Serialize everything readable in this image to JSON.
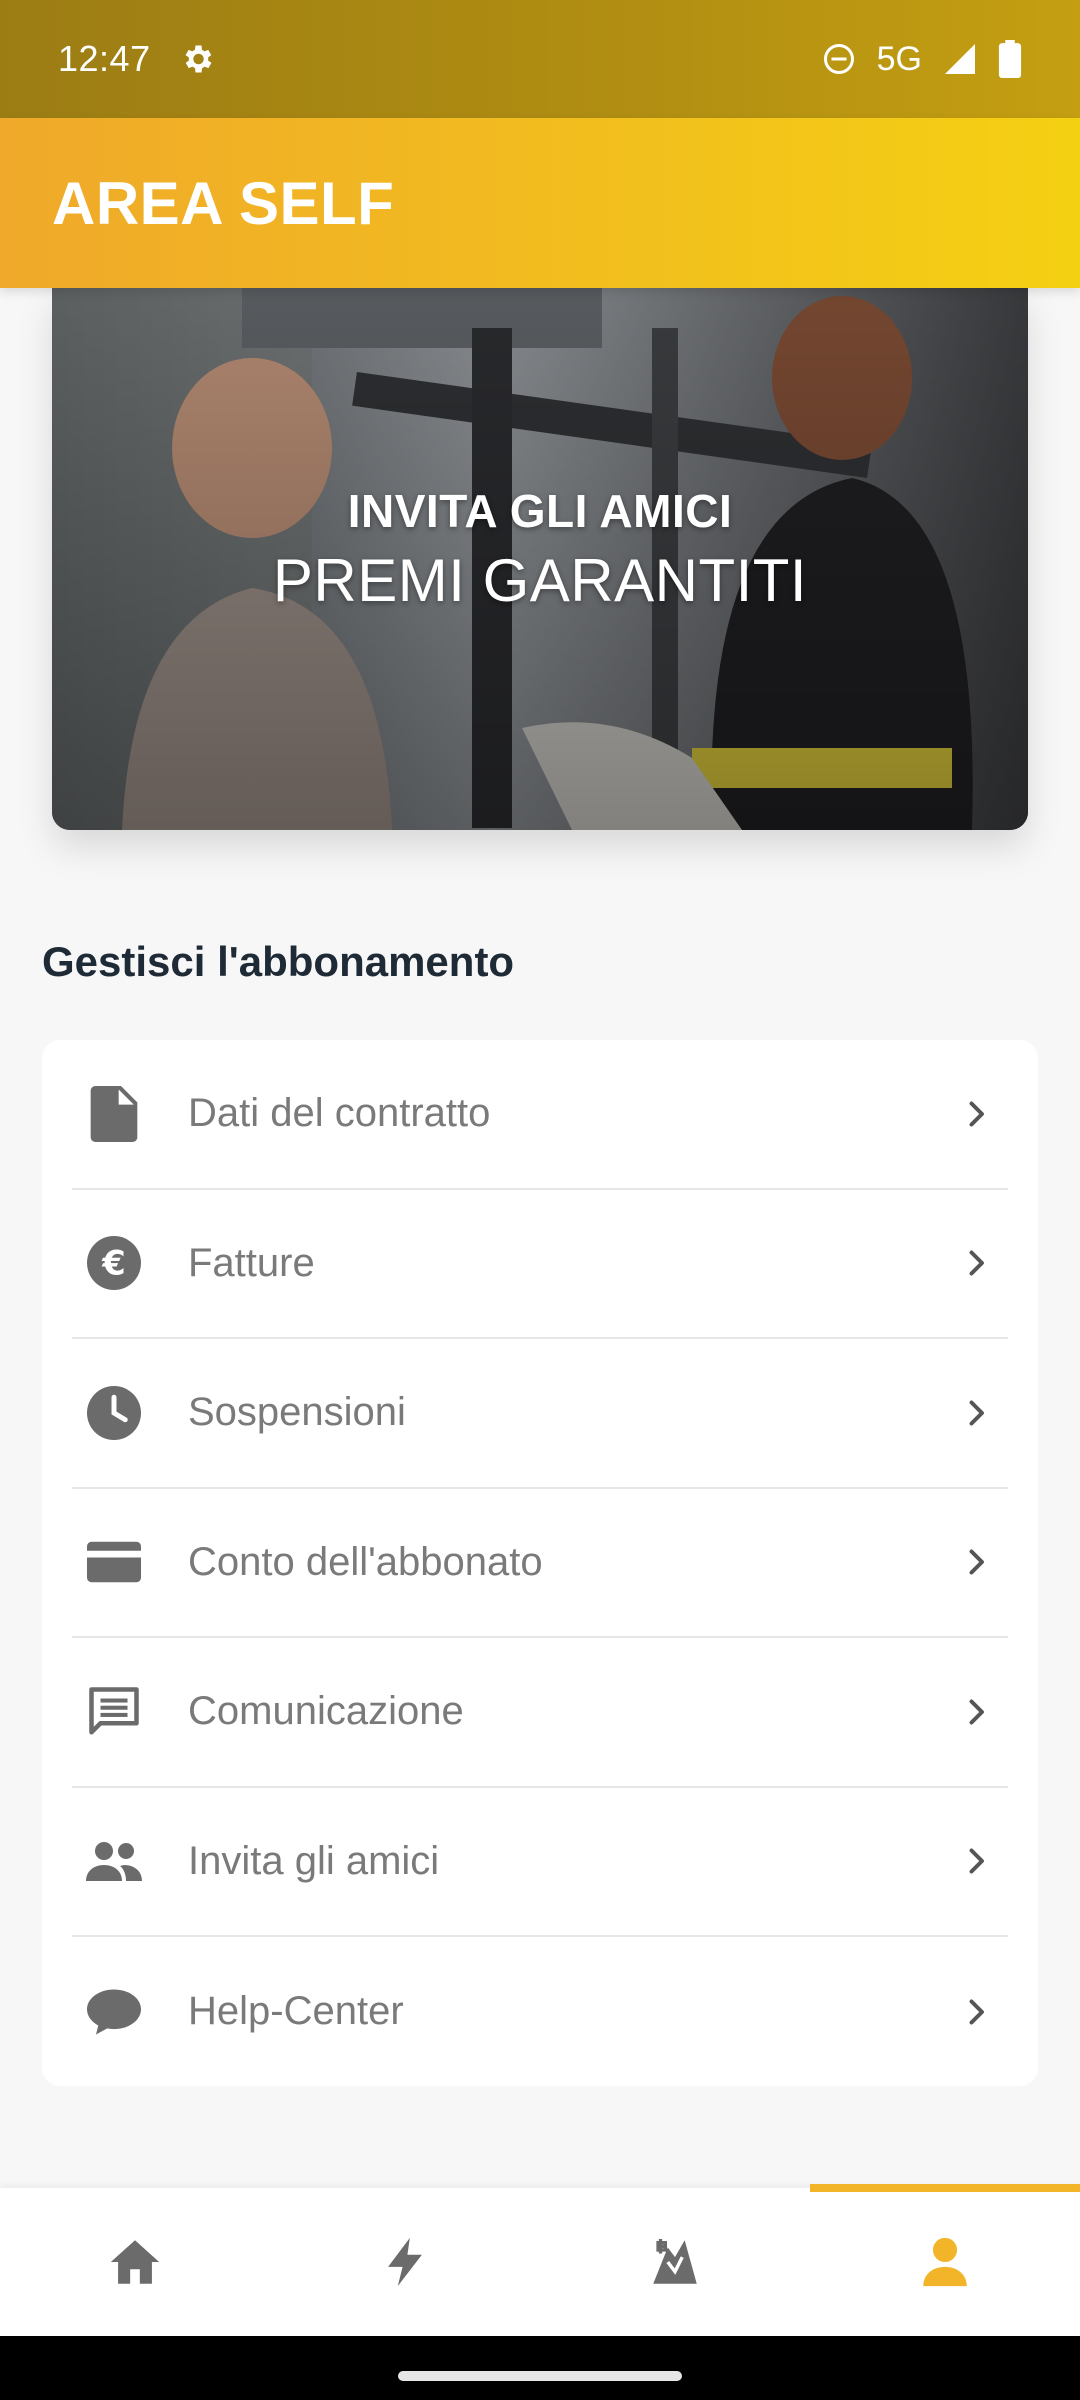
{
  "status_bar": {
    "time": "12:47",
    "network": "5G"
  },
  "header": {
    "title": "AREA SELF"
  },
  "banner": {
    "line1": "INVITA GLI AMICI",
    "line2": "PREMI GARANTITI"
  },
  "section": {
    "title": "Gestisci l'abbonamento"
  },
  "menu": {
    "items": [
      {
        "label": "Dati del contratto",
        "icon": "document-icon"
      },
      {
        "label": "Fatture",
        "icon": "euro-icon"
      },
      {
        "label": "Sospensioni",
        "icon": "clock-icon"
      },
      {
        "label": "Conto dell'abbonato",
        "icon": "credit-card-icon"
      },
      {
        "label": "Comunicazione",
        "icon": "message-icon"
      },
      {
        "label": "Invita gli amici",
        "icon": "people-icon"
      },
      {
        "label": "Help-Center",
        "icon": "chat-bubble-icon"
      }
    ]
  },
  "bottom_nav": {
    "items": [
      {
        "icon": "home-icon",
        "active": false
      },
      {
        "icon": "lightning-icon",
        "active": false
      },
      {
        "icon": "sport-icon",
        "active": false
      },
      {
        "icon": "profile-icon",
        "active": true
      }
    ]
  },
  "colors": {
    "accent": "#f2b52a",
    "icon_gray": "#6b6b6b",
    "label_gray": "#7a7a7a"
  }
}
